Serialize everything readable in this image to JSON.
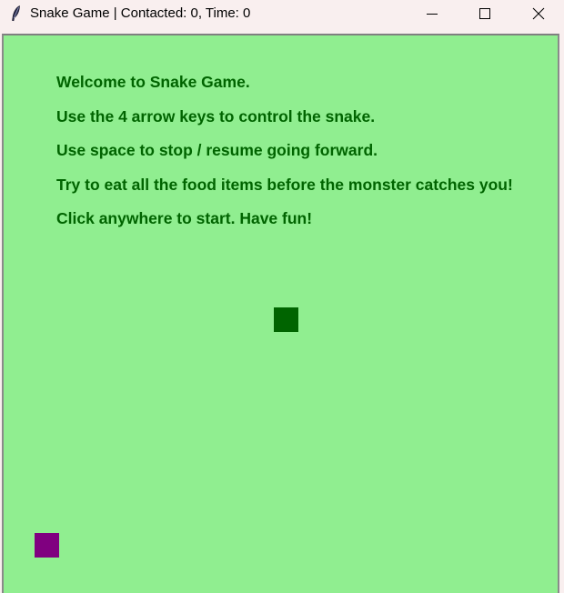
{
  "window": {
    "title": "Snake Game | Contacted: 0, Time: 0",
    "icon": "feather-icon",
    "controls": {
      "minimize_icon": "minimize-icon",
      "maximize_icon": "maximize-icon",
      "close_icon": "close-icon"
    }
  },
  "game": {
    "instructions": [
      "Welcome to Snake Game.",
      "Use the 4 arrow keys to control the snake.",
      "Use space to stop / resume going forward.",
      "Try to eat all the food items before the monster catches you!",
      "Click anywhere to start. Have fun!"
    ],
    "colors": {
      "background": "#90ee90",
      "text": "#006400",
      "food": "#006400",
      "monster": "#800080"
    }
  }
}
